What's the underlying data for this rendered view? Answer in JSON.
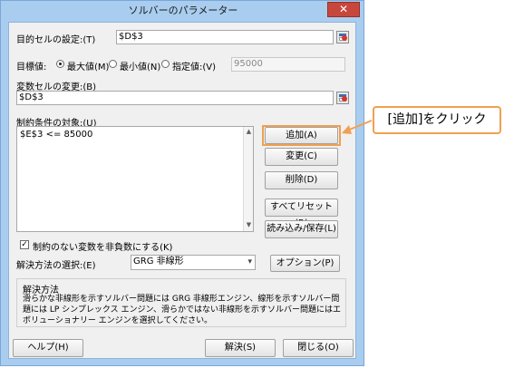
{
  "window": {
    "title": "ソルバーのパラメーター",
    "close_glyph": "✕"
  },
  "objective": {
    "label": "目的セルの設定:(T)",
    "value": "$D$3"
  },
  "target": {
    "label": "目標値:",
    "options": [
      {
        "label": "最大値(M)",
        "selected": true
      },
      {
        "label": "最小値(N)",
        "selected": false
      },
      {
        "label": "指定値:(V)",
        "selected": false
      }
    ],
    "value_field": "95000"
  },
  "variables": {
    "label": "変数セルの変更:(B)",
    "value": "$D$3"
  },
  "constraints": {
    "label": "制約条件の対象:(U)",
    "items": [
      "$E$3 <= 85000"
    ]
  },
  "buttons": {
    "add": "追加(A)",
    "change": "変更(C)",
    "delete": "削除(D)",
    "reset_all": "すべてリセット(R)",
    "load_save": "読み込み/保存(L)",
    "options": "オプション(P)",
    "help": "ヘルプ(H)",
    "solve": "解決(S)",
    "close": "閉じる(O)"
  },
  "nonneg": {
    "label": "制約のない変数を非負数にする(K)",
    "checked": true
  },
  "method": {
    "label": "解決方法の選択:(E)",
    "value": "GRG 非線形"
  },
  "method_group": {
    "title": "解決方法",
    "description": "滑らかな非線形を示すソルバー問題には GRG 非線形エンジン、線形を示すソルバー問題には LP シンプレックス エンジン、滑らかではない非線形を示すソルバー問題にはエボリューショナリー エンジンを選択してください。"
  },
  "annotation": {
    "text": "[追加]をクリック",
    "color": "#f0a050"
  },
  "icons": {
    "range": "range-select-icon",
    "dropdown": "chevron-down-icon",
    "check": "checkmark-icon",
    "arrow": "arrow-left-icon"
  }
}
